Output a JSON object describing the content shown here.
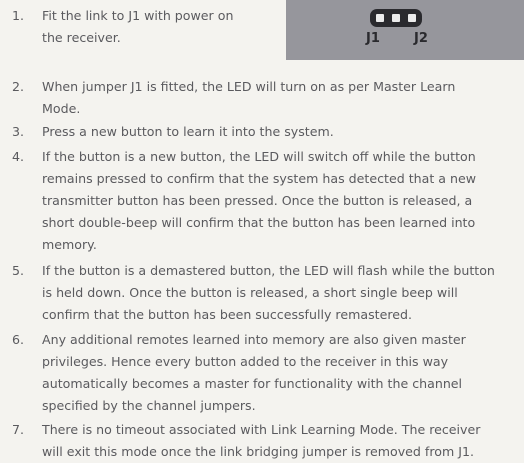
{
  "jumper_figure": {
    "label_j1": "J1",
    "label_j2": "J2"
  },
  "steps": [
    {
      "number": "1.",
      "lines": [
        "Fit the link to J1 with power on",
        "the receiver."
      ]
    },
    {
      "number": "2.",
      "lines": [
        "When jumper J1 is fitted, the LED will turn on as per Master Learn",
        "Mode."
      ]
    },
    {
      "number": "3.",
      "lines": [
        "Press a new button to learn it into the system."
      ]
    },
    {
      "number": "4.",
      "lines": [
        "If the button is a new button, the LED will switch off while the button",
        "remains pressed to confirm that the system has detected that a new",
        "transmitter button has been pressed.  Once the button is released, a",
        "short double-beep will confirm that the button has been learned into",
        "memory."
      ]
    },
    {
      "number": "5.",
      "lines": [
        "If the button is a demastered button, the LED will flash while the button",
        "is held down.  Once the button is released, a short single beep will",
        "confirm that the button has been successfully remastered."
      ]
    },
    {
      "number": "6.",
      "lines": [
        "Any additional remotes learned into memory are also given master",
        "privileges.  Hence every button added to the receiver in this way",
        "automatically becomes a master for functionality with the channel",
        "specified by the channel jumpers."
      ]
    },
    {
      "number": "7.",
      "lines": [
        "There is no timeout associated with Link Learning Mode.  The receiver",
        "will exit this mode once the link bridging jumper is removed from J1."
      ]
    }
  ]
}
